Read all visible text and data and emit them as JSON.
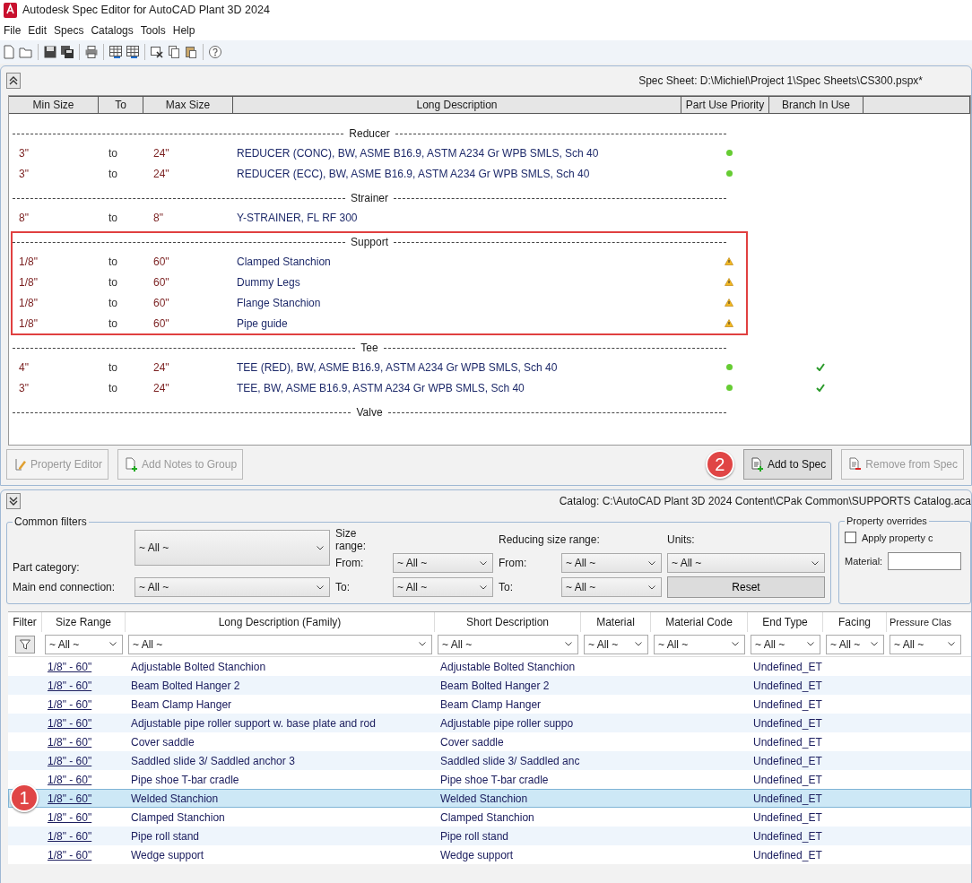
{
  "window": {
    "title": "Autodesk Spec Editor for AutoCAD Plant 3D 2024"
  },
  "menu": [
    "File",
    "Edit",
    "Specs",
    "Catalogs",
    "Tools",
    "Help"
  ],
  "toolbar": [
    {
      "kind": "new"
    },
    {
      "kind": "open"
    },
    {
      "kind": "sep"
    },
    {
      "kind": "save"
    },
    {
      "kind": "save-all"
    },
    {
      "kind": "sep"
    },
    {
      "kind": "print"
    },
    {
      "kind": "sep"
    },
    {
      "kind": "table"
    },
    {
      "kind": "table"
    },
    {
      "kind": "sep"
    },
    {
      "kind": "delete"
    },
    {
      "kind": "copy"
    },
    {
      "kind": "paste"
    },
    {
      "kind": "sep"
    },
    {
      "kind": "help"
    }
  ],
  "spec_sheet": {
    "path": "Spec Sheet: D:\\Michiel\\Project 1\\Spec Sheets\\CS300.pspx*",
    "columns": [
      "Min Size",
      "To",
      "Max Size",
      "Long Description",
      "Part Use Priority",
      "Branch In Use"
    ],
    "groups": [
      {
        "name": "Reducer",
        "highlighted": false,
        "rows": [
          {
            "min": "3\"",
            "to": "to",
            "max": "24\"",
            "description": "REDUCER (CONC), BW, ASME B16.9, ASTM A234 Gr WPB SMLS, Sch 40",
            "kind": "ok",
            "branch_in_use": false
          },
          {
            "min": "3\"",
            "to": "to",
            "max": "24\"",
            "description": "REDUCER (ECC), BW, ASME B16.9, ASTM A234 Gr WPB SMLS, Sch 40",
            "kind": "ok",
            "branch_in_use": false
          }
        ]
      },
      {
        "name": "Strainer",
        "highlighted": false,
        "rows": [
          {
            "min": "8\"",
            "to": "to",
            "max": "8\"",
            "description": "Y-STRAINER, FL RF 300",
            "kind": "plain",
            "branch_in_use": false
          }
        ]
      },
      {
        "name": "Support",
        "highlighted": true,
        "rows": [
          {
            "min": "1/8\"",
            "to": "to",
            "max": "60\"",
            "description": "Clamped Stanchion",
            "kind": "warning",
            "branch_in_use": false
          },
          {
            "min": "1/8\"",
            "to": "to",
            "max": "60\"",
            "description": "Dummy Legs",
            "kind": "warning",
            "branch_in_use": false
          },
          {
            "min": "1/8\"",
            "to": "to",
            "max": "60\"",
            "description": "Flange Stanchion",
            "kind": "warning",
            "branch_in_use": false
          },
          {
            "min": "1/8\"",
            "to": "to",
            "max": "60\"",
            "description": "Pipe guide",
            "kind": "warning",
            "branch_in_use": false
          }
        ]
      },
      {
        "name": "Tee",
        "highlighted": false,
        "rows": [
          {
            "min": "4\"",
            "to": "to",
            "max": "24\"",
            "description": "TEE (RED), BW, ASME B16.9, ASTM A234 Gr WPB SMLS, Sch 40",
            "kind": "ok",
            "branch_in_use": true
          },
          {
            "min": "3\"",
            "to": "to",
            "max": "24\"",
            "description": "TEE, BW, ASME B16.9, ASTM A234 Gr WPB SMLS, Sch 40",
            "kind": "ok",
            "branch_in_use": true
          }
        ]
      },
      {
        "name": "Valve",
        "highlighted": false
      }
    ]
  },
  "spec_buttons": [
    {
      "kind": "edit",
      "label": "Property Editor",
      "disabled": true
    },
    {
      "kind": "notes",
      "label": "Add Notes to Group",
      "disabled": true
    },
    {
      "kind": "add",
      "label": "Add to Spec",
      "disabled": false,
      "badge": "2"
    },
    {
      "kind": "remove",
      "label": "Remove from Spec",
      "disabled": true
    }
  ],
  "catalog": {
    "path": "Catalog: C:\\AutoCAD Plant 3D 2024 Content\\CPak Common\\SUPPORTS Catalog.aca",
    "common_filters": {
      "title": "Common filters",
      "part_category_label": "Part category:",
      "part_category": "~ All ~",
      "main_end_label": "Main end connection:",
      "main_end": "~ All ~",
      "size_range_label": "Size range:",
      "size_from_label": "From:",
      "size_from": "~ All ~",
      "size_to_label": "To:",
      "size_to": "~ All ~",
      "reducing_label": "Reducing size range:",
      "reducing_from_label": "From:",
      "reducing_from": "~ All ~",
      "reducing_to_label": "To:",
      "reducing_to": "~ All ~",
      "units_label": "Units:",
      "units": "~ All ~",
      "reset": "Reset"
    },
    "property_overrides": {
      "title": "Property overrides",
      "apply_label": "Apply property c",
      "apply_checked": false,
      "material_label": "Material:"
    },
    "columns": [
      "Filter",
      "Size Range",
      "Long Description (Family)",
      "Short Description",
      "Material",
      "Material Code",
      "End Type",
      "Facing",
      "Pressure Clas"
    ],
    "column_filters": [
      "~ All ~",
      "~ All ~",
      "~ All ~",
      "~ All ~",
      "~ All ~",
      "~ All ~",
      "~ All ~",
      "~ All ~"
    ],
    "rows": [
      {
        "size_range": "1/8\" - 60\"",
        "long": "Adjustable Bolted Stanchion",
        "short": "Adjustable Bolted Stanchion",
        "end_type": "Undefined_ET",
        "selected": false
      },
      {
        "size_range": "1/8\" - 60\"",
        "long": "Beam Bolted Hanger 2",
        "short": "Beam Bolted Hanger 2",
        "end_type": "Undefined_ET",
        "selected": false
      },
      {
        "size_range": "1/8\" - 60\"",
        "long": "Beam Clamp Hanger",
        "short": "Beam Clamp Hanger",
        "end_type": "Undefined_ET",
        "selected": false
      },
      {
        "size_range": "1/8\" - 60\"",
        "long": "Adjustable pipe roller support w. base plate and rod",
        "short": "Adjustable pipe roller suppo",
        "end_type": "Undefined_ET",
        "selected": false
      },
      {
        "size_range": "1/8\" - 60\"",
        "long": "Cover saddle",
        "short": "Cover saddle",
        "end_type": "Undefined_ET",
        "selected": false
      },
      {
        "size_range": "1/8\" - 60\"",
        "long": "Saddled slide 3/ Saddled anchor 3",
        "short": "Saddled slide 3/ Saddled anc",
        "end_type": "Undefined_ET",
        "selected": false
      },
      {
        "size_range": "1/8\" - 60\"",
        "long": "Pipe shoe T-bar cradle",
        "short": "Pipe shoe T-bar cradle",
        "end_type": "Undefined_ET",
        "selected": false
      },
      {
        "size_range": "1/8\" - 60\"",
        "long": "Welded Stanchion",
        "short": "Welded Stanchion",
        "end_type": "Undefined_ET",
        "selected": true,
        "badge": "1"
      },
      {
        "size_range": "1/8\" - 60\"",
        "long": "Clamped Stanchion",
        "short": "Clamped Stanchion",
        "end_type": "Undefined_ET",
        "selected": false
      },
      {
        "size_range": "1/8\" - 60\"",
        "long": "Pipe roll stand",
        "short": "Pipe roll stand",
        "end_type": "Undefined_ET",
        "selected": false
      },
      {
        "size_range": "1/8\" - 60\"",
        "long": "Wedge support",
        "short": "Wedge support",
        "end_type": "Undefined_ET",
        "selected": false
      }
    ]
  }
}
